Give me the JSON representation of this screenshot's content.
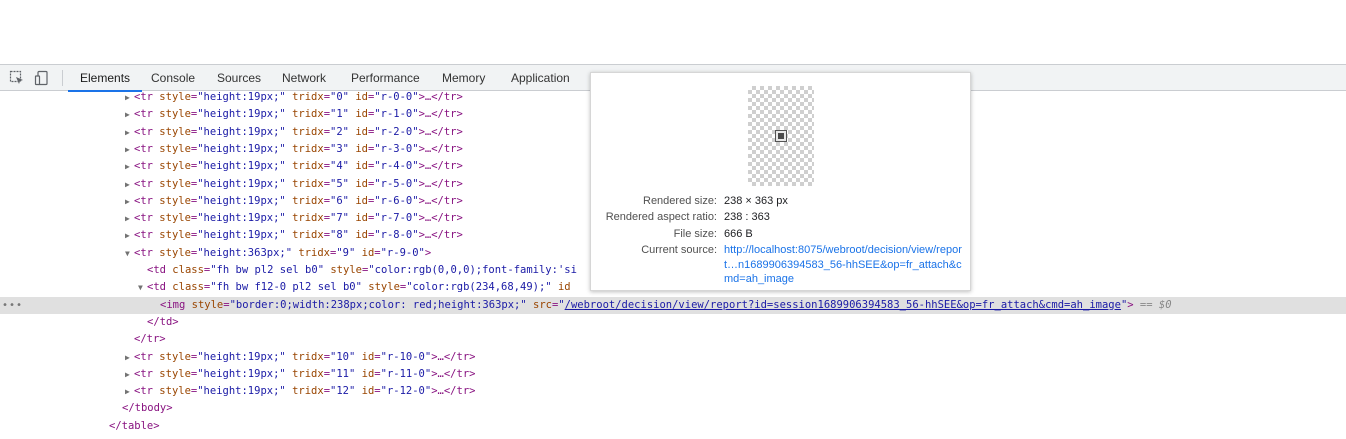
{
  "toolbar": {
    "tabs": [
      {
        "label": "Elements"
      },
      {
        "label": "Console"
      },
      {
        "label": "Sources"
      },
      {
        "label": "Network"
      },
      {
        "label": "Performance"
      },
      {
        "label": "Memory"
      },
      {
        "label": "Application"
      }
    ],
    "active_tab": "Elements",
    "accent_color": "#1a73e8"
  },
  "dom": {
    "rows": [
      {
        "tridx": "0",
        "id": "r-0-0"
      },
      {
        "tridx": "1",
        "id": "r-1-0"
      },
      {
        "tridx": "2",
        "id": "r-2-0"
      },
      {
        "tridx": "3",
        "id": "r-3-0"
      },
      {
        "tridx": "4",
        "id": "r-4-0"
      },
      {
        "tridx": "5",
        "id": "r-5-0"
      },
      {
        "tridx": "6",
        "id": "r-6-0"
      },
      {
        "tridx": "7",
        "id": "r-7-0"
      },
      {
        "tridx": "8",
        "id": "r-8-0"
      }
    ],
    "row_style": "height:19px;",
    "expanded_row": {
      "style": "height:363px;",
      "tridx": "9",
      "id": "r-9-0"
    },
    "td1": {
      "class": "fh bw pl2 sel b0",
      "style": "color:rgb(0,0,0);font-family:'si"
    },
    "td2": {
      "class": "fh bw f12-0 pl2 sel b0",
      "style": "color:rgb(234,68,49);",
      "trailing": "id"
    },
    "img": {
      "style": "border:0;width:238px;color: red;height:363px;",
      "src": "/webroot/decision/view/report?id=session1689906394583_56-hhSEE&op=fr_attach&cmd=ah_image",
      "suffix": "== $0"
    },
    "close_td": "</td>",
    "close_tr": "</tr>",
    "rows_after": [
      {
        "tridx": "10",
        "id": "r-10-0"
      },
      {
        "tridx": "11",
        "id": "r-11-0"
      },
      {
        "tridx": "12",
        "id": "r-12-0"
      }
    ],
    "close_tbody": "</tbody>",
    "close_table": "</table>"
  },
  "popover": {
    "rendered_size_label": "Rendered size:",
    "rendered_size_value": "238 × 363 px",
    "aspect_label": "Rendered aspect ratio:",
    "aspect_value": "238 : 363",
    "file_size_label": "File size:",
    "file_size_value": "666 B",
    "source_label": "Current source:",
    "source_value": "http://localhost:8075/webroot/decision/view/report…n1689906394583_56-hhSEE&op=fr_attach&cmd=ah_image"
  }
}
